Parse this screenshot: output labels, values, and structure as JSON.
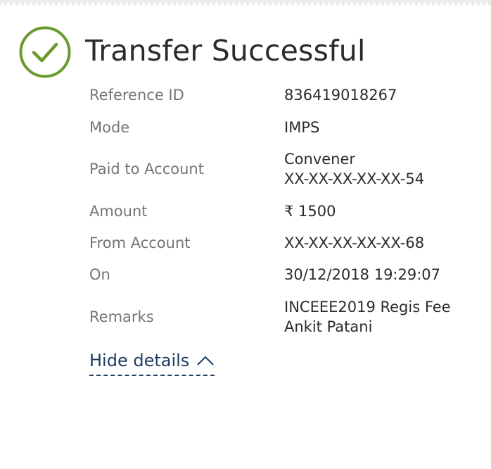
{
  "header": {
    "title": "Transfer Successful",
    "status_icon": "checkmark-circle-icon",
    "accent_color": "#6a9a2c"
  },
  "details": [
    {
      "label": "Reference ID",
      "value_lines": [
        "836419018267"
      ]
    },
    {
      "label": "Mode",
      "value_lines": [
        "IMPS"
      ]
    },
    {
      "label": "Paid to Account",
      "value_lines": [
        "Convener",
        "XX-XX-XX-XX-XX-54"
      ]
    },
    {
      "label": "Amount",
      "value_lines": [
        "₹ 1500"
      ]
    },
    {
      "label": "From Account",
      "value_lines": [
        "XX-XX-XX-XX-XX-68"
      ]
    },
    {
      "label": "On",
      "value_lines": [
        "30/12/2018 19:29:07"
      ]
    },
    {
      "label": "Remarks",
      "value_lines": [
        "INCEEE2019 Regis Fee",
        "Ankit Patani"
      ]
    }
  ],
  "toggle": {
    "label": "Hide details",
    "icon": "chevron-up-icon",
    "color": "#1f3b63"
  }
}
